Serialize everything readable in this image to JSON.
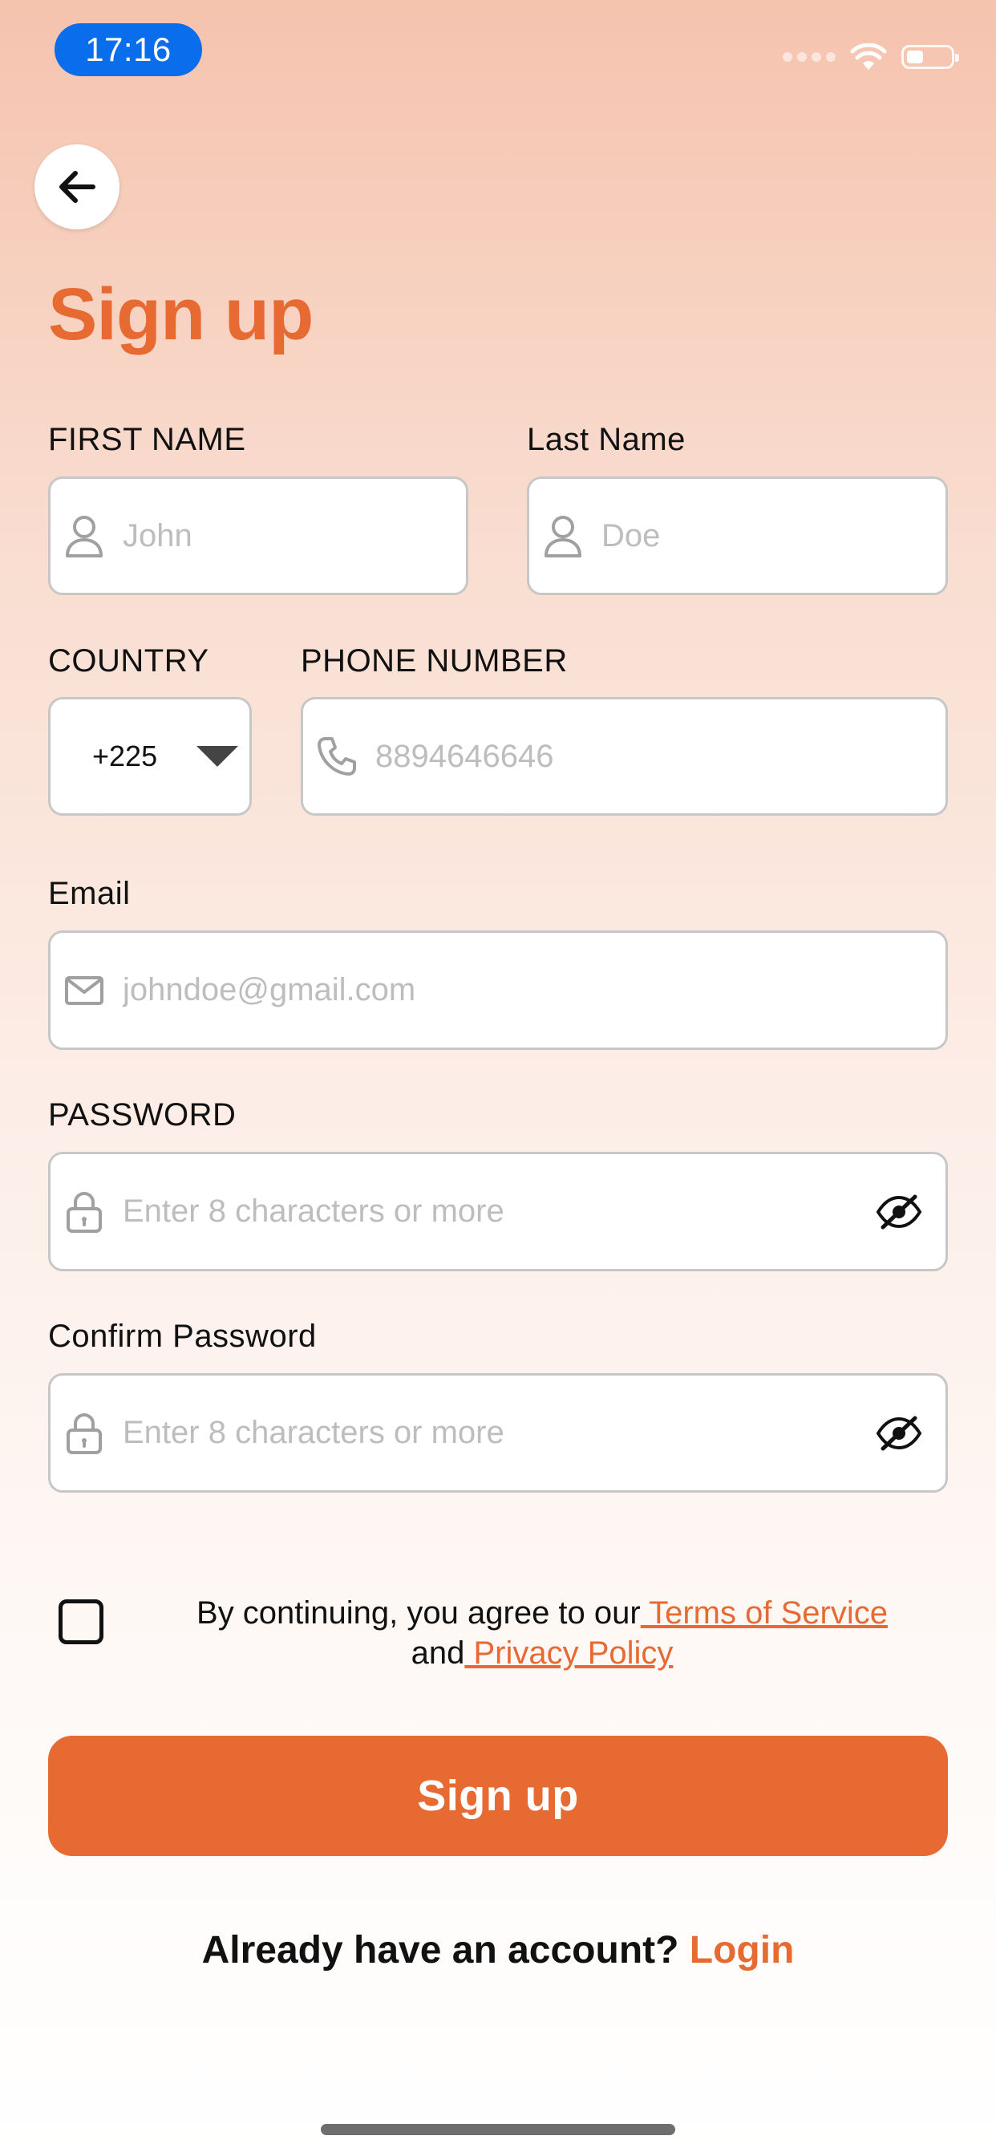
{
  "status_bar": {
    "time": "17:16"
  },
  "page": {
    "title": "Sign up"
  },
  "form": {
    "first_name": {
      "label": "FIRST NAME",
      "placeholder": "John",
      "value": ""
    },
    "last_name": {
      "label": "Last Name",
      "placeholder": "Doe",
      "value": ""
    },
    "country": {
      "label": "COUNTRY",
      "selected": "+225"
    },
    "phone": {
      "label": "PHONE NUMBER",
      "placeholder": "8894646646",
      "value": ""
    },
    "email": {
      "label": "Email",
      "placeholder": "johndoe@gmail.com",
      "value": ""
    },
    "password": {
      "label": "PASSWORD",
      "placeholder": "Enter 8 characters or more",
      "value": ""
    },
    "confirm_password": {
      "label": "Confirm Password",
      "placeholder": "Enter 8 characters or more",
      "value": ""
    }
  },
  "terms": {
    "checked": false,
    "prefix": "By continuing, you agree to our",
    "terms_link": " Terms of Service",
    "middle": "and",
    "privacy_link": " Privacy Policy"
  },
  "actions": {
    "signup_label": "Sign up",
    "login_prompt": "Already have an account? ",
    "login_link": "Login"
  },
  "icons": {
    "back": "arrow-left-icon",
    "first_name": "user-icon",
    "last_name": "user-icon",
    "country": "caret-down-icon",
    "phone": "phone-icon",
    "email": "mail-icon",
    "password": "lock-icon",
    "password_toggle": "eye-off-icon"
  },
  "colors": {
    "accent": "#E86A33",
    "time_pill": "#0A6DEB",
    "input_border": "#C7C7C7",
    "placeholder": "#BDBDBD"
  }
}
